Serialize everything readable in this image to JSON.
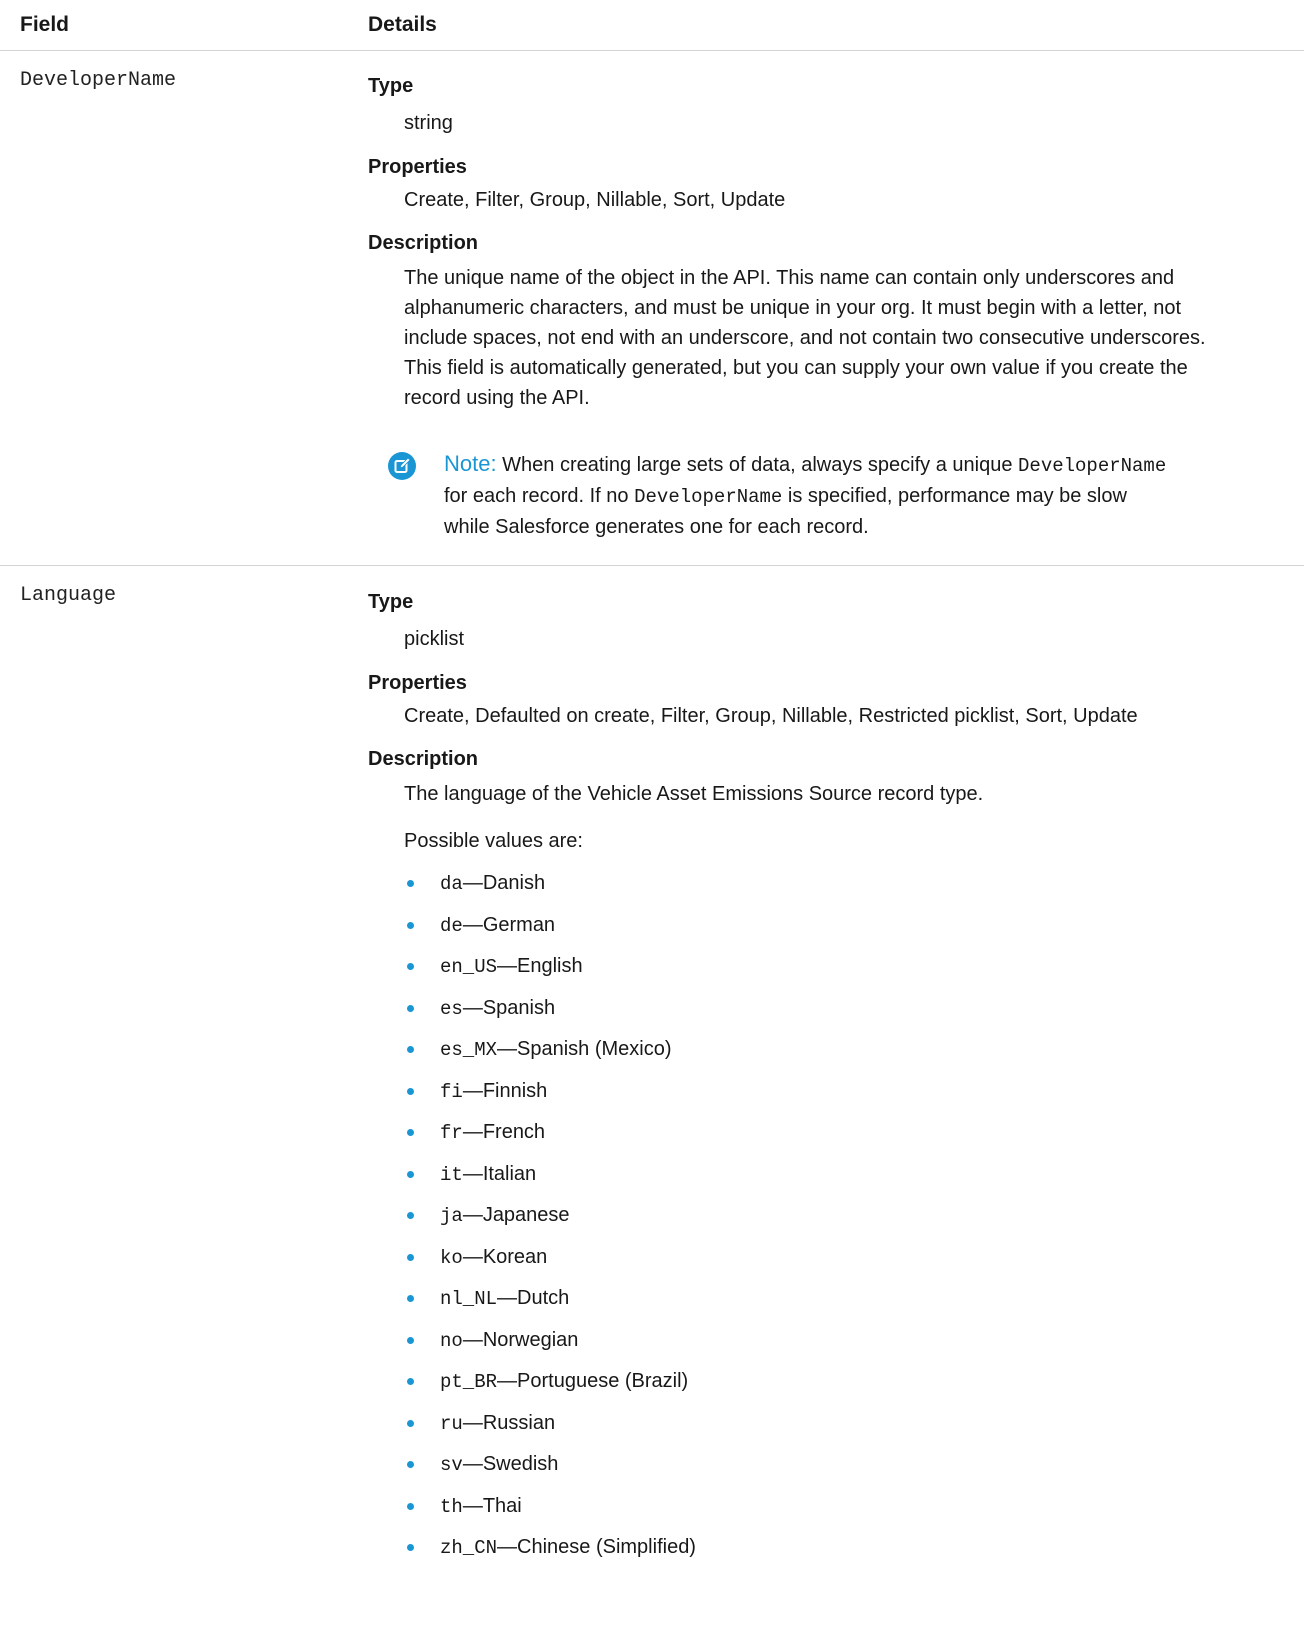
{
  "header": {
    "field_label": "Field",
    "details_label": "Details"
  },
  "fields": [
    {
      "name": "DeveloperName",
      "type_label": "Type",
      "type_value": "string",
      "properties_label": "Properties",
      "properties_value": "Create, Filter, Group, Nillable, Sort, Update",
      "description_label": "Description",
      "description_lines": [
        "The unique name of the object in the API. This name can contain only underscores and",
        "alphanumeric characters, and must be unique in your org. It must begin with a letter, not",
        "include spaces, not end with an underscore, and not contain two consecutive underscores.",
        "This field is automatically generated, but you can supply your own value if you create the",
        "record using the API."
      ],
      "note": {
        "icon": "edit-note-icon",
        "label": "Note:",
        "line1_text": "When creating large sets of data, always specify a unique",
        "line1_code": "DeveloperName",
        "line2_pre": "for each record. If no",
        "line2_code": "DeveloperName",
        "line2_post": "is specified, performance may be slow",
        "line3": "while Salesforce generates one for each record."
      }
    },
    {
      "name": "Language",
      "type_label": "Type",
      "type_value": "picklist",
      "properties_label": "Properties",
      "properties_value": "Create, Defaulted on create, Filter, Group, Nillable, Restricted picklist, Sort, Update",
      "description_label": "Description",
      "description_text": "The language of the Vehicle Asset Emissions Source record type.",
      "possible_values_intro": "Possible values are:",
      "values": [
        {
          "code": "da",
          "label": "—Danish"
        },
        {
          "code": "de",
          "label": "—German"
        },
        {
          "code": "en_US",
          "label": "—English"
        },
        {
          "code": "es",
          "label": "—Spanish"
        },
        {
          "code": "es_MX",
          "label": "—Spanish (Mexico)"
        },
        {
          "code": "fi",
          "label": "—Finnish"
        },
        {
          "code": "fr",
          "label": "—French"
        },
        {
          "code": "it",
          "label": "—Italian"
        },
        {
          "code": "ja",
          "label": "—Japanese"
        },
        {
          "code": "ko",
          "label": "—Korean"
        },
        {
          "code": "nl_NL",
          "label": "—Dutch"
        },
        {
          "code": "no",
          "label": "—Norwegian"
        },
        {
          "code": "pt_BR",
          "label": "—Portuguese (Brazil)"
        },
        {
          "code": "ru",
          "label": "—Russian"
        },
        {
          "code": "sv",
          "label": "—Swedish"
        },
        {
          "code": "th",
          "label": "—Thai"
        },
        {
          "code": "zh_CN",
          "label": "—Chinese (Simplified)"
        }
      ]
    }
  ],
  "colors": {
    "accent": "#1b96d4",
    "divider": "#d4d4d4",
    "text": "#181818"
  }
}
